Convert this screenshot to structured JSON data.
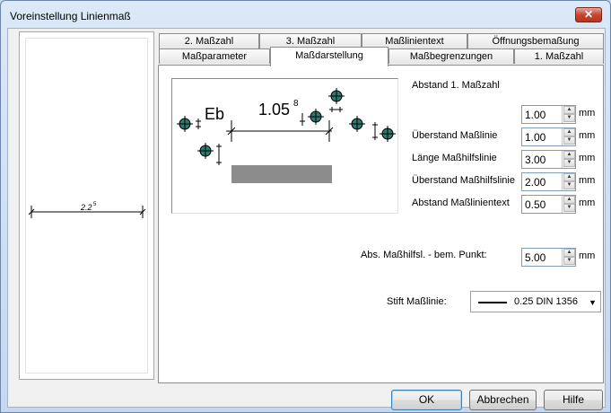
{
  "window": {
    "title": "Voreinstellung Linienmaß",
    "close_glyph": "✕"
  },
  "preview": {
    "dimension_text": "2.2",
    "dimension_sup": "5"
  },
  "tabs": {
    "back_row": [
      "2. Maßzahl",
      "3. Maßzahl",
      "Maßlinientext",
      "Öffnungsbemaßung"
    ],
    "front_row": [
      "Maßparameter",
      "Maßdarstellung",
      "Maßbegrenzungen",
      "1. Maßzahl"
    ],
    "active": "Maßdarstellung"
  },
  "sketch": {
    "label_eb": "Eb",
    "dim_value": "1.05",
    "dim_sup": "8"
  },
  "fields": [
    {
      "label": "Abstand 1. Maßzahl",
      "value": "1.00",
      "unit": "mm"
    },
    {
      "label": "Überstand Maßlinie",
      "value": "1.00",
      "unit": "mm"
    },
    {
      "label": "Länge Maßhilfslinie",
      "value": "3.00",
      "unit": "mm"
    },
    {
      "label": "Überstand Maßhilfslinie",
      "value": "2.00",
      "unit": "mm"
    },
    {
      "label": "Abstand  Maßlinientext",
      "value": "0.50",
      "unit": "mm"
    }
  ],
  "abs_field": {
    "label": "Abs. Maßhilfsl. - bem. Punkt:",
    "value": "5.00",
    "unit": "mm"
  },
  "pen": {
    "label": "Stift Maßlinie:",
    "value": "0.25 DIN 1356"
  },
  "buttons": {
    "ok": "OK",
    "cancel": "Abbrechen",
    "help": "Hilfe"
  }
}
